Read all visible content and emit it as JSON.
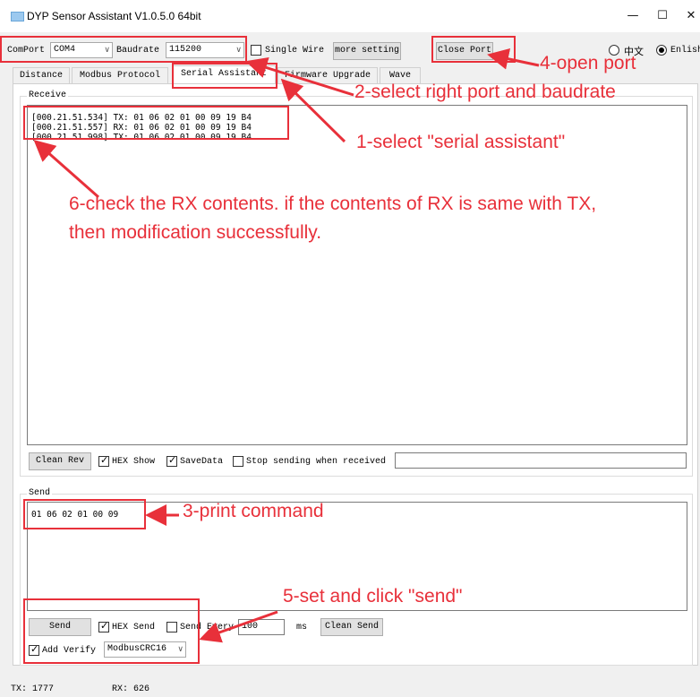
{
  "window": {
    "title": "DYP Sensor Assistant V1.0.5.0 64bit",
    "minimize": "—",
    "maximize": "☐",
    "close": "✕"
  },
  "toolbar": {
    "comport_label": "ComPort",
    "comport_value": "COM4",
    "baudrate_label": "Baudrate",
    "baudrate_value": "115200",
    "single_wire_label": "Single Wire",
    "more_setting": "more setting",
    "close_port": "Close Port",
    "lang_cn": "中文",
    "lang_en": "Enlish"
  },
  "tabs": [
    {
      "label": "Distance"
    },
    {
      "label": "Modbus Protocol"
    },
    {
      "label": "Serial Assistant"
    },
    {
      "label": "Firmware Upgrade"
    },
    {
      "label": "Wave"
    }
  ],
  "receive": {
    "label": "Receive",
    "lines": [
      "[000.21.51.534] TX: 01 06 02 01 00 09 19 B4",
      "[000.21.51.557] RX: 01 06 02 01 00 09 19 B4",
      "[000.21.51.998] TX: 01 06 02 01 00 09 19 B4"
    ],
    "clean_rev": "Clean Rev",
    "hex_show": "HEX Show",
    "save_data": "SaveData",
    "stop_sending": "Stop sending when received",
    "filter_value": ""
  },
  "send": {
    "label": "Send",
    "command": "01 06 02 01 00 09",
    "send_button": "Send",
    "hex_send": "HEX Send",
    "send_every": "Send Every",
    "interval": "100",
    "ms": "ms",
    "clean_send": "Clean Send",
    "add_verify": "Add Verify",
    "verify_mode": "ModbusCRC16"
  },
  "status": {
    "tx": "TX: 1777",
    "rx": "RX: 626"
  },
  "annotations": {
    "a1": "1-select \"serial assistant\"",
    "a2": "2-select right port and baudrate",
    "a3": "3-print command",
    "a4": "4-open port",
    "a5": "5-set and click \"send\"",
    "a6_line1": "6-check the RX contents. if the contents of RX is same with TX,",
    "a6_line2": "then modification successfully."
  },
  "colors": {
    "annotation": "#e8303a",
    "panel": "#ffffff",
    "chrome": "#f0f0f0"
  }
}
